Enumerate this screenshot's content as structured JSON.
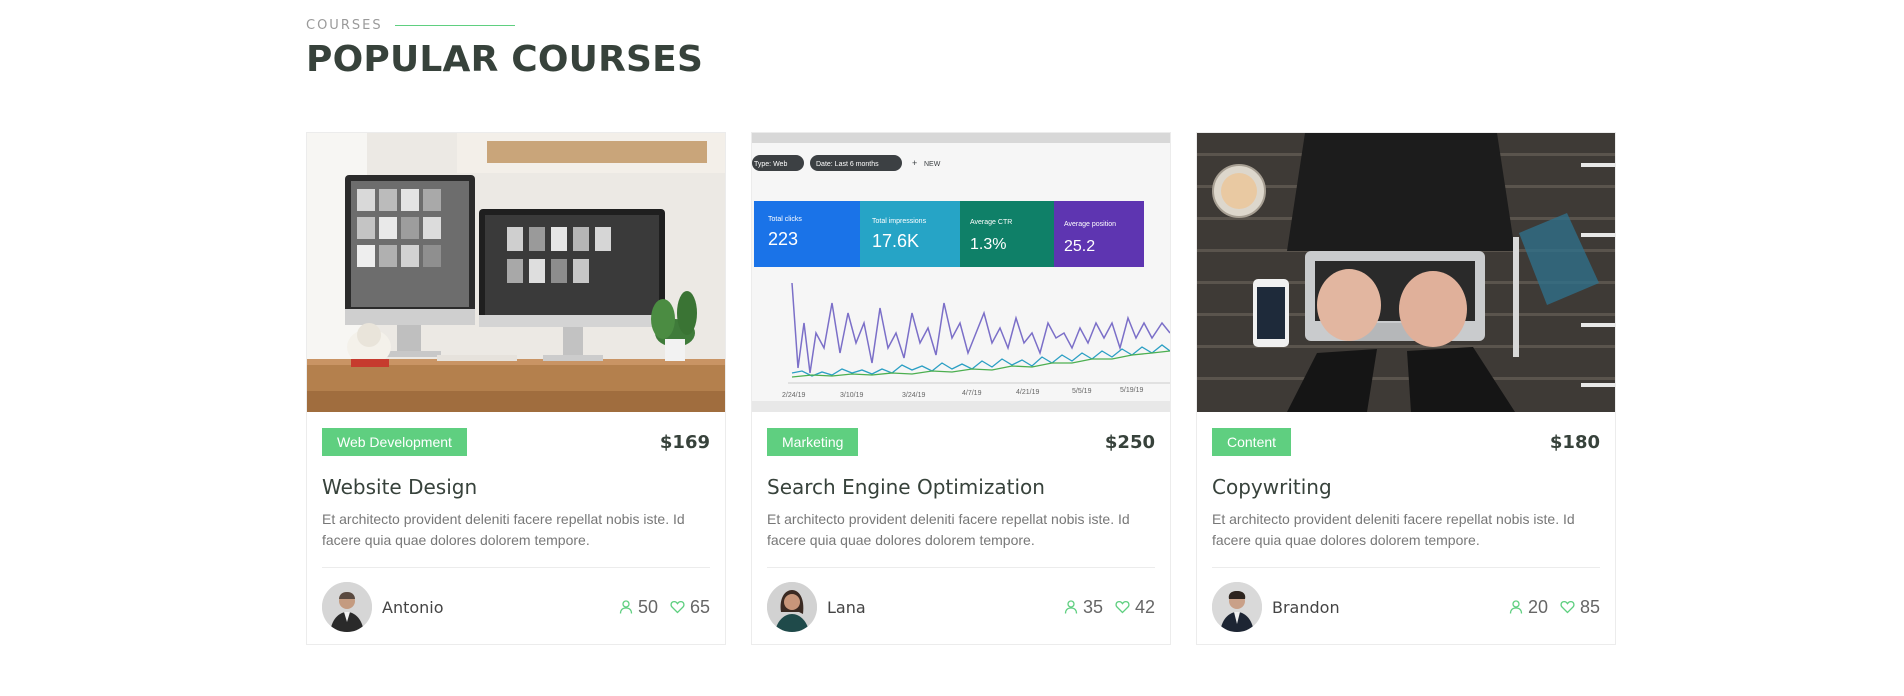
{
  "section": {
    "eyebrow": "COURSES",
    "title": "POPULAR COURSES"
  },
  "colors": {
    "accent": "#5fcf80",
    "heading": "#37423b",
    "muted": "#777777"
  },
  "courses": [
    {
      "category": "Web Development",
      "price": "$169",
      "title": "Website Design",
      "description": "Et architecto provident deleniti facere repellat nobis iste. Id facere quia quae dolores dolorem tempore.",
      "trainer": "Antonio",
      "students": "50",
      "likes": "65",
      "image": "desk-monitors-photo"
    },
    {
      "category": "Marketing",
      "price": "$250",
      "title": "Search Engine Optimization",
      "description": "Et architecto provident deleniti facere repellat nobis iste. Id facere quia quae dolores dolorem tempore.",
      "trainer": "Lana",
      "students": "35",
      "likes": "42",
      "image": "analytics-dashboard-photo",
      "dashboard": {
        "chips": [
          "Type: Web",
          "Date: Last 6 months",
          "NEW"
        ],
        "metrics": [
          {
            "label": "Total clicks",
            "value": "223"
          },
          {
            "label": "Total impressions",
            "value": "17.6K"
          },
          {
            "label": "Average CTR",
            "value": "1.3%"
          },
          {
            "label": "Average position",
            "value": "25.2"
          }
        ],
        "dates": [
          "2/24/19",
          "3/10/19",
          "3/24/19",
          "4/7/19",
          "4/21/19",
          "5/5/19",
          "5/19/19"
        ]
      }
    },
    {
      "category": "Content",
      "price": "$180",
      "title": "Copywriting",
      "description": "Et architecto provident deleniti facere repellat nobis iste. Id facere quia quae dolores dolorem tempore.",
      "trainer": "Brandon",
      "students": "20",
      "likes": "85",
      "image": "laptop-typing-photo"
    }
  ]
}
